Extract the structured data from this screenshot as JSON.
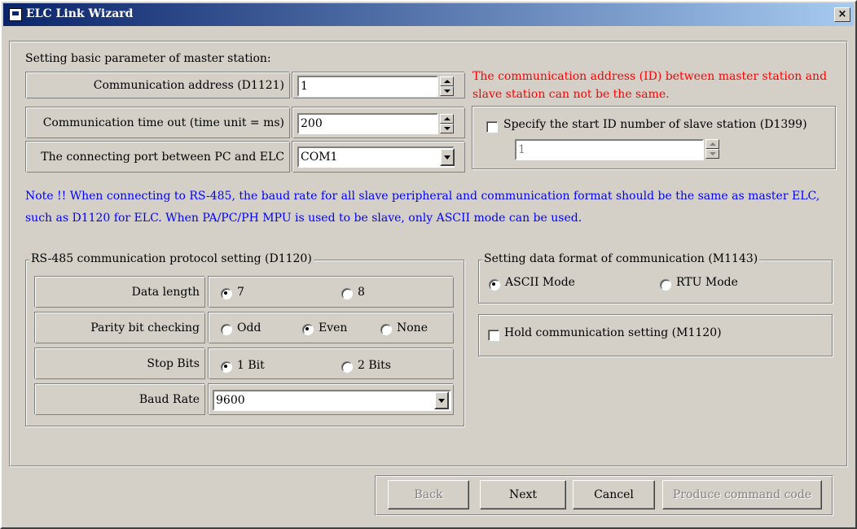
{
  "window": {
    "title": "ELC Link Wizard",
    "close_glyph": "×"
  },
  "master": {
    "heading": "Setting basic parameter of master station:",
    "address_label": "Communication address (D1121)",
    "address_value": "1",
    "timeout_label": "Communication time out (time unit = ms)",
    "timeout_value": "200",
    "port_label": "The connecting port between PC and ELC",
    "port_value": "COM1",
    "warning_line1": "The communication address (ID) between master station and",
    "warning_line2": "slave station can not be the same.",
    "slave_checkbox_label": "Specify the start ID number of slave station  (D1399)",
    "slave_start_value": "1"
  },
  "note": {
    "line1": "Note !! When connecting to RS-485, the baud rate for all slave peripheral and communication format should  be the same as master ELC,",
    "line2": "such as D1120 for ELC.  When PA/PC/PH MPU is used to be slave, only ASCII mode can be used."
  },
  "protocol": {
    "title": "RS-485 communication protocol setting (D1120)",
    "data_length_label": "Data length",
    "data_length_options": [
      "7",
      "8"
    ],
    "data_length_selected": "7",
    "parity_label": "Parity bit checking",
    "parity_options": [
      "Odd",
      "Even",
      "None"
    ],
    "parity_selected": "Even",
    "stop_bits_label": "Stop Bits",
    "stop_bits_options": [
      "1 Bit",
      "2 Bits"
    ],
    "stop_bits_selected": "1 Bit",
    "baud_label": "Baud Rate",
    "baud_value": "9600"
  },
  "format": {
    "title": "Setting data format of communication (M1143)",
    "options": [
      "ASCII Mode",
      "RTU Mode"
    ],
    "selected": "ASCII Mode",
    "hold_label": "Hold communication setting  (M1120)"
  },
  "buttons": {
    "back": "Back",
    "next": "Next",
    "cancel": "Cancel",
    "produce": "Produce command code"
  },
  "colors": {
    "warning": "#ff0000",
    "note": "#0000ff",
    "titlebar": "#0a246a"
  }
}
